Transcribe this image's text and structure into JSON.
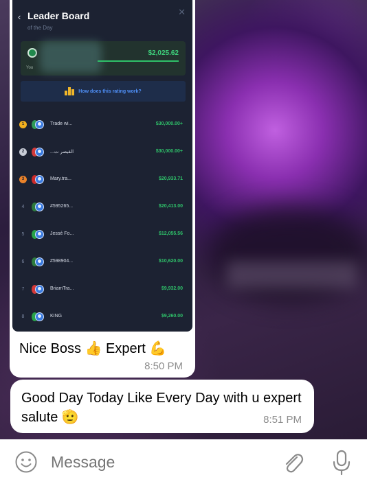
{
  "leaderboard": {
    "title": "Leader Board",
    "subtitle": "of the Day",
    "you_label": "You",
    "you_amount": "$2,025.62",
    "rating_link": "How does this rating work?",
    "rows": [
      {
        "rank": "1",
        "name": "Trade wi...",
        "amount": "$30,000.00+",
        "rank_color": "#f2b01e",
        "flag_color": "#2f9a57"
      },
      {
        "rank": "2",
        "name": "...القيصر ت",
        "amount": "$30,000.00+",
        "rank_color": "#c9ced8",
        "flag_color": "#d23a3a"
      },
      {
        "rank": "3",
        "name": "Mary.tra...",
        "amount": "$20,933.71",
        "rank_color": "#e9822a",
        "flag_color": "#cc2a2a"
      },
      {
        "rank": "4",
        "name": "#595265...",
        "amount": "$20,413.00",
        "rank_color": "",
        "flag_color": "#2d7a3d"
      },
      {
        "rank": "5",
        "name": "Jessé Fo...",
        "amount": "$12,055.56",
        "rank_color": "",
        "flag_color": "#28a248"
      },
      {
        "rank": "6",
        "name": "#598904...",
        "amount": "$10,620.00",
        "rank_color": "",
        "flag_color": "#2d7a3d"
      },
      {
        "rank": "7",
        "name": "BriamTra...",
        "amount": "$9,932.00",
        "rank_color": "",
        "flag_color": "#d43838"
      },
      {
        "rank": "8",
        "name": "KING",
        "amount": "$9,260.00",
        "rank_color": "",
        "flag_color": "#28a248"
      }
    ]
  },
  "messages": [
    {
      "text": "Nice Boss 👍 Expert 💪",
      "time": "8:50 PM"
    },
    {
      "text": "Good Day Today Like Every Day with u expert salute 🫡",
      "time": "8:51 PM"
    }
  ],
  "composer": {
    "placeholder": "Message"
  },
  "icons": {
    "emoji": "smile-icon",
    "attach": "paperclip-icon",
    "voice": "microphone-icon"
  }
}
